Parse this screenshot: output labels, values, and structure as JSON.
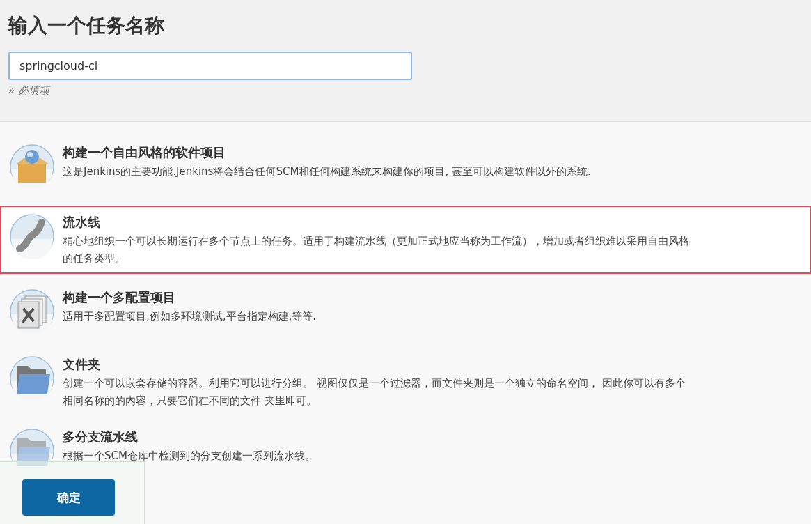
{
  "header": {
    "title": "输入一个任务名称",
    "name_field": {
      "value": "springcloud-ci"
    },
    "required_note": "» 必填项"
  },
  "job_types": [
    {
      "kind": "freestyle",
      "title": "构建一个自由风格的软件项目",
      "description_lines": [
        "这是Jenkins的主要功能.Jenkins将会结合任何SCM和任何构建系统来构建你的项目, 甚至可以构建软件以外的系统."
      ],
      "selected": false
    },
    {
      "kind": "pipeline",
      "title": "流水线",
      "description_lines": [
        "精心地组织一个可以长期运行在多个节点上的任务。适用于构建流水线（更加正式地应当称为工作流），增加或者组织难以采用自由风格",
        "的任务类型。"
      ],
      "selected": true
    },
    {
      "kind": "multiconfig",
      "title": "构建一个多配置项目",
      "description_lines": [
        "适用于多配置项目,例如多环境测试,平台指定构建,等等."
      ],
      "selected": false
    },
    {
      "kind": "folder",
      "title": "文件夹",
      "description_lines": [
        "创建一个可以嵌套存储的容器。利用它可以进行分组。 视图仅仅是一个过滤器，而文件夹则是一个独立的命名空间， 因此你可以有多个",
        "相同名称的的内容，只要它们在不同的文件 夹里即可。"
      ],
      "selected": false
    },
    {
      "kind": "multibranch",
      "title": "多分支流水线",
      "description_lines": [
        "根据一个SCM仓库中检测到的分支创建一系列流水线。"
      ],
      "selected": false
    }
  ],
  "footer": {
    "ok_button": "确定"
  }
}
